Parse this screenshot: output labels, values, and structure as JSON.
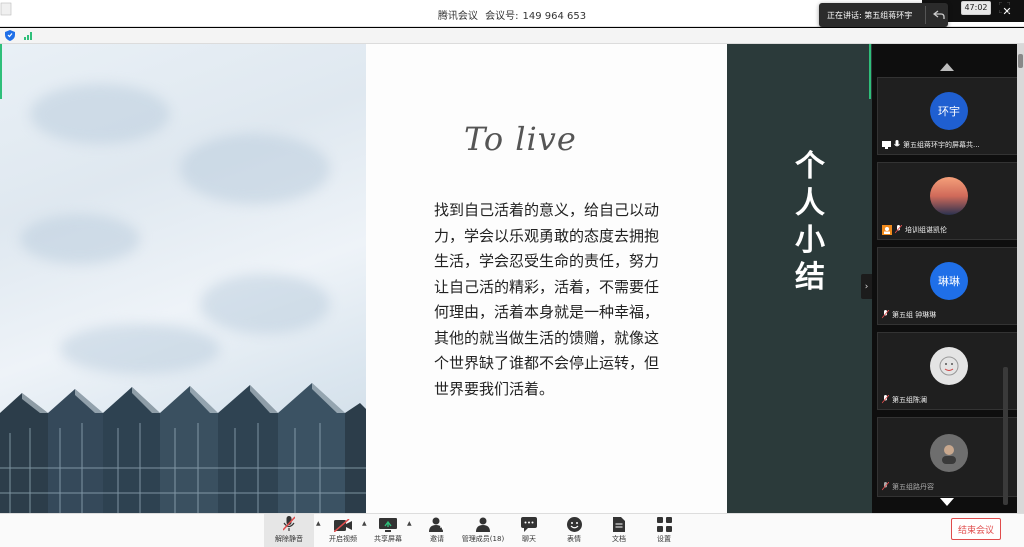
{
  "window": {
    "app_name": "腾讯会议",
    "meeting_id_label": "会议号:",
    "meeting_id": "149 964 653"
  },
  "speaking_toast": {
    "label": "正在讲话: 第五组蒋环宇"
  },
  "status": {
    "timer": "47:02"
  },
  "slide": {
    "title": "To live",
    "body": "找到自己活着的意义，给自己以动力，学会以乐观勇敢的态度去拥抱生活，学会忍受生命的责任，努力让自己活的精彩，活着，不需要任何理由，活着本身就是一种幸福，其他的就当做生活的馈赠，就像这个世界缺了谁都不会停止运转，但世界要我们活着。",
    "side_title": "个人小结"
  },
  "participants": [
    {
      "avatar_text": "环宇",
      "name": "第五组蒋环宇的屏幕共...",
      "avatar_color": "#1f5fd1"
    },
    {
      "avatar_text": "",
      "name": "培训组谌凯伦",
      "avatar_color": "#e88b6a"
    },
    {
      "avatar_text": "琳琳",
      "name": "第五组 钟琳琳",
      "avatar_color": "#1f6fe8"
    },
    {
      "avatar_text": "",
      "name": "第五组陈澜",
      "avatar_color": "#dddddd"
    },
    {
      "avatar_text": "",
      "name": "第五组路丹容",
      "avatar_color": "#777777"
    }
  ],
  "toolbar": {
    "unmute": "解除静音",
    "video": "开启视频",
    "share": "共享屏幕",
    "invite": "邀请",
    "members": "管理成员(18)",
    "chat": "聊天",
    "reactions": "表情",
    "docs": "文档",
    "settings": "设置",
    "end_meeting": "结束会议"
  },
  "colors": {
    "accent_blue": "#1f6fe8",
    "end_red": "#e04c4c",
    "slide_dark": "#2b3a3a",
    "highlight_green": "#2fbf7a"
  }
}
